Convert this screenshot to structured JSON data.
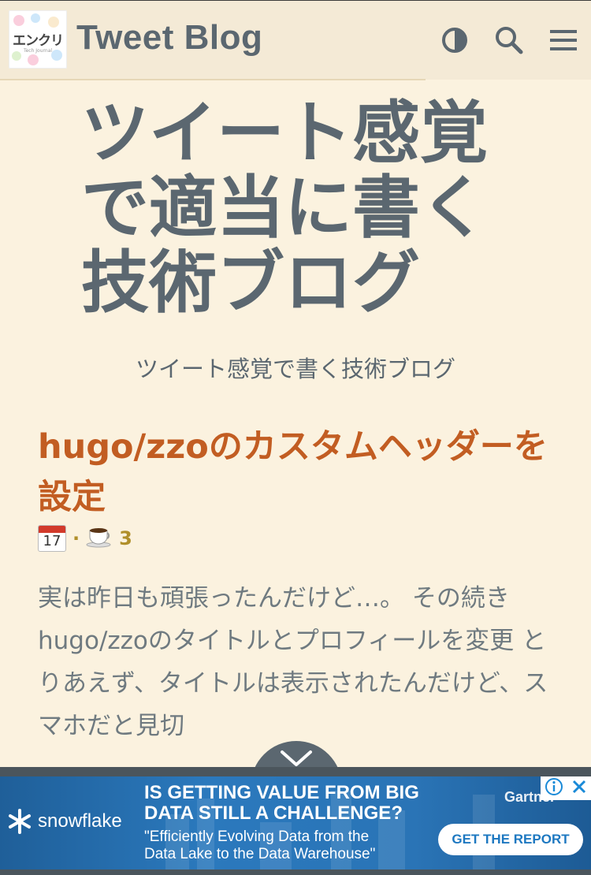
{
  "header": {
    "logo_text": "エンクリ",
    "logo_sub": "Tech Journal",
    "title": "Tweet Blog",
    "icons": [
      "theme-toggle-icon",
      "search-icon",
      "menu-icon"
    ]
  },
  "hero": {
    "title": "ツイート感覚で適当に書く技術ブログ",
    "subtitle": "ツイート感覚で書く技術ブログ"
  },
  "post": {
    "title": "hugo/zzoのカスタムヘッダーを設定",
    "calendar_day": "17",
    "separator": "·",
    "reading_time": "3",
    "excerpt": "実は昨日も頑張ったんだけど…。 その続き hugo/zzoのタイトルとプロフィールを変更 とりあえず、タイトルは表示されたんだけど、スマホだと見切"
  },
  "ad": {
    "brand": "snowflake",
    "headline_1": "IS GETTING VALUE FROM BIG",
    "headline_2": "DATA STILL A CHALLENGE?",
    "quote_1": "\"Efficiently Evolving Data from the",
    "quote_2": "Data Lake to the Data Warehouse\"",
    "sponsor": "Gartner",
    "cta": "GET THE REPORT"
  },
  "colors": {
    "background": "#fbf2df",
    "header_bg": "#f4ead6",
    "text": "#5b6770",
    "accent": "#c25d22",
    "meta": "#b08f2a",
    "ad_blue": "#2b79bd"
  }
}
